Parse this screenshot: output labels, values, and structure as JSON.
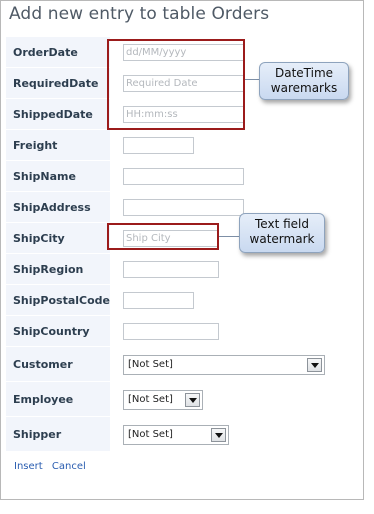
{
  "page": {
    "title": "Add new entry to table Orders"
  },
  "fields": [
    {
      "label": "OrderDate",
      "placeholder": "dd/MM/yyyy",
      "width": "wide"
    },
    {
      "label": "RequiredDate",
      "placeholder": "Required Date",
      "width": "wide"
    },
    {
      "label": "ShippedDate",
      "placeholder": "HH:mm:ss",
      "width": "wide"
    },
    {
      "label": "Freight",
      "placeholder": "",
      "width": "short"
    },
    {
      "label": "ShipName",
      "placeholder": "",
      "width": "wide"
    },
    {
      "label": "ShipAddress",
      "placeholder": "",
      "width": "wide"
    },
    {
      "label": "ShipCity",
      "placeholder": "Ship City",
      "width": "mid"
    },
    {
      "label": "ShipRegion",
      "placeholder": "",
      "width": "mid"
    },
    {
      "label": "ShipPostalCode",
      "placeholder": "",
      "width": "short"
    },
    {
      "label": "ShipCountry",
      "placeholder": "",
      "width": "mid"
    }
  ],
  "dropdowns": [
    {
      "label": "Customer",
      "value": "[Not Set]"
    },
    {
      "label": "Employee",
      "value": "[Not Set]"
    },
    {
      "label": "Shipper",
      "value": "[Not Set]"
    }
  ],
  "actions": {
    "insert": "Insert",
    "cancel": "Cancel"
  },
  "callouts": {
    "datetime": "DateTime waremarks",
    "textfield": "Text field watermark"
  },
  "colors": {
    "highlight": "#9b1b1b",
    "link": "#2a5db0",
    "label": "#2d3e4f"
  }
}
